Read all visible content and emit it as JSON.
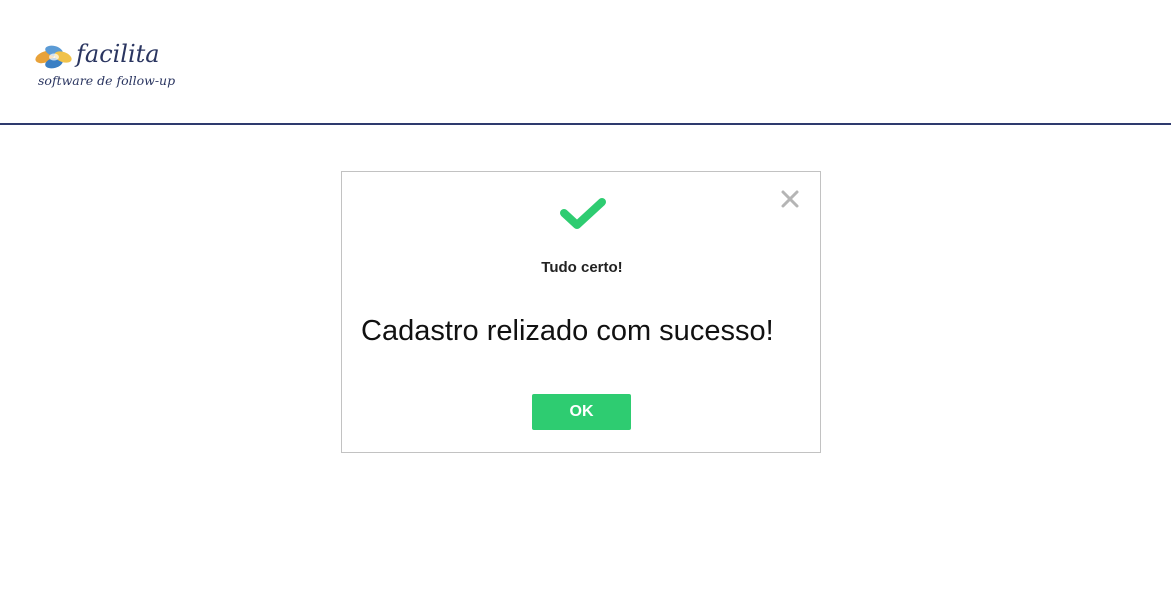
{
  "header": {
    "logo": {
      "name": "facilita",
      "tagline": "software de follow-up"
    },
    "border_color": "#2e3a6e"
  },
  "modal": {
    "icon": "check-icon",
    "close_icon": "close-icon",
    "title": "Tudo certo!",
    "message": "Cadastro relizado com sucesso!",
    "ok_label": "OK",
    "accent_color": "#2ecc71"
  }
}
